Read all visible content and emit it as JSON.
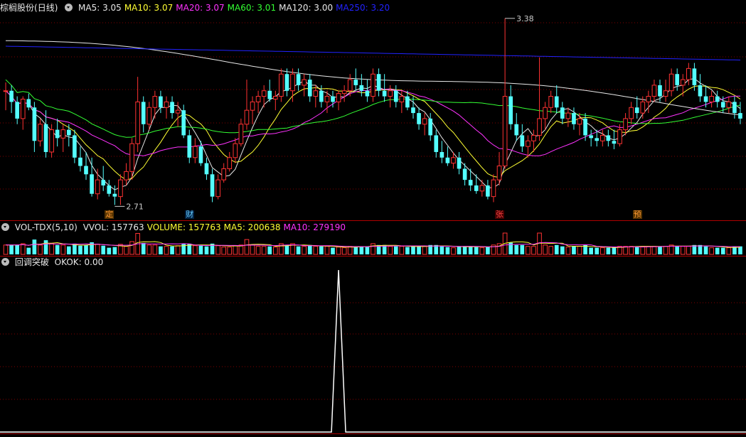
{
  "price_panel": {
    "stock_name": "棕榈股份",
    "period": "(日线)",
    "ma": [
      {
        "label": "MA5: 3.05",
        "color": "#e8e8e8"
      },
      {
        "label": "MA10: 3.07",
        "color": "#ffff33"
      },
      {
        "label": "MA20: 3.07",
        "color": "#ff33ff"
      },
      {
        "label": "MA60: 3.01",
        "color": "#33ff33"
      },
      {
        "label": "MA120: 3.00",
        "color": "#e8e8e8"
      },
      {
        "label": "MA250: 3.20",
        "color": "#2222ff"
      }
    ],
    "high_label": "3.38",
    "low_label": "2.71",
    "event_markers": [
      {
        "text": "定",
        "color": "#ff9933",
        "bg": "#553300"
      },
      {
        "text": "财",
        "color": "#66ccff",
        "bg": "#002244"
      },
      {
        "text": "张",
        "color": "#ff4444",
        "bg": "#440000"
      },
      {
        "text": "预",
        "color": "#ff9933",
        "bg": "#553300"
      }
    ]
  },
  "volume_panel": {
    "indicator": "VOL-TDX(5,10)",
    "items": [
      {
        "label": "VVOL: 157763",
        "color": "#e8e8e8"
      },
      {
        "label": "VOLUME: 157763",
        "color": "#ffff33"
      },
      {
        "label": "MA5: 200638",
        "color": "#ffff33"
      },
      {
        "label": "MA10: 279190",
        "color": "#ff33ff"
      }
    ]
  },
  "signal_panel": {
    "indicator": "回调突破",
    "value_label": "OKOK: 0.00"
  },
  "colors": {
    "up": "#ff3232",
    "down": "#54ffff",
    "grid": "#800000",
    "background": "#000000"
  },
  "chart_data": {
    "type": "candlestick",
    "candles": [
      [
        3.12,
        3.15,
        3.05,
        3.12
      ],
      [
        3.12,
        3.14,
        3.04,
        3.08
      ],
      [
        3.08,
        3.1,
        3.0,
        3.02
      ],
      [
        3.02,
        3.1,
        2.98,
        3.09
      ],
      [
        3.09,
        3.11,
        3.05,
        3.06
      ],
      [
        3.06,
        3.08,
        2.9,
        2.94
      ],
      [
        2.94,
        3.02,
        2.92,
        3.0
      ],
      [
        3.0,
        3.05,
        2.88,
        2.9
      ],
      [
        2.9,
        3.0,
        2.88,
        2.98
      ],
      [
        2.98,
        3.02,
        2.92,
        2.95
      ],
      [
        2.95,
        3.0,
        2.9,
        2.98
      ],
      [
        2.98,
        3.0,
        2.92,
        2.96
      ],
      [
        2.96,
        2.98,
        2.86,
        2.88
      ],
      [
        2.88,
        2.92,
        2.83,
        2.85
      ],
      [
        2.85,
        2.9,
        2.8,
        2.82
      ],
      [
        2.82,
        2.88,
        2.74,
        2.75
      ],
      [
        2.75,
        2.84,
        2.73,
        2.8
      ],
      [
        2.8,
        2.85,
        2.76,
        2.78
      ],
      [
        2.78,
        2.8,
        2.74,
        2.75
      ],
      [
        2.75,
        2.78,
        2.71,
        2.74
      ],
      [
        2.74,
        2.82,
        2.71,
        2.8
      ],
      [
        2.8,
        2.86,
        2.78,
        2.83
      ],
      [
        2.83,
        2.95,
        2.8,
        2.93
      ],
      [
        2.93,
        3.17,
        2.9,
        3.08
      ],
      [
        3.08,
        3.1,
        2.97,
        3.0
      ],
      [
        3.0,
        3.08,
        2.98,
        3.06
      ],
      [
        3.06,
        3.12,
        3.02,
        3.1
      ],
      [
        3.1,
        3.12,
        3.04,
        3.06
      ],
      [
        3.06,
        3.1,
        3.02,
        3.08
      ],
      [
        3.08,
        3.1,
        3.02,
        3.04
      ],
      [
        3.04,
        3.08,
        2.99,
        3.05
      ],
      [
        3.05,
        3.07,
        2.95,
        2.96
      ],
      [
        2.96,
        2.98,
        2.86,
        2.88
      ],
      [
        2.88,
        2.95,
        2.86,
        2.92
      ],
      [
        2.92,
        2.94,
        2.85,
        2.86
      ],
      [
        2.86,
        2.88,
        2.8,
        2.82
      ],
      [
        2.82,
        2.84,
        2.72,
        2.74
      ],
      [
        2.74,
        2.82,
        2.73,
        2.8
      ],
      [
        2.8,
        2.86,
        2.79,
        2.84
      ],
      [
        2.84,
        2.9,
        2.83,
        2.88
      ],
      [
        2.88,
        2.95,
        2.86,
        2.93
      ],
      [
        2.93,
        3.02,
        2.92,
        3.0
      ],
      [
        3.0,
        3.16,
        2.98,
        3.05
      ],
      [
        3.05,
        3.1,
        3.0,
        3.08
      ],
      [
        3.08,
        3.12,
        3.04,
        3.1
      ],
      [
        3.1,
        3.14,
        3.06,
        3.12
      ],
      [
        3.12,
        3.16,
        3.08,
        3.09
      ],
      [
        3.09,
        3.12,
        3.05,
        3.1
      ],
      [
        3.1,
        3.2,
        3.08,
        3.18
      ],
      [
        3.18,
        3.2,
        3.1,
        3.12
      ],
      [
        3.12,
        3.2,
        3.08,
        3.18
      ],
      [
        3.18,
        3.2,
        3.12,
        3.14
      ],
      [
        3.14,
        3.18,
        3.1,
        3.16
      ],
      [
        3.16,
        3.18,
        3.08,
        3.1
      ],
      [
        3.1,
        3.14,
        3.06,
        3.12
      ],
      [
        3.12,
        3.14,
        3.06,
        3.08
      ],
      [
        3.08,
        3.12,
        3.04,
        3.1
      ],
      [
        3.1,
        3.12,
        3.06,
        3.08
      ],
      [
        3.08,
        3.12,
        3.05,
        3.11
      ],
      [
        3.11,
        3.14,
        3.08,
        3.12
      ],
      [
        3.12,
        3.18,
        3.1,
        3.16
      ],
      [
        3.16,
        3.2,
        3.12,
        3.14
      ],
      [
        3.14,
        3.18,
        3.1,
        3.12
      ],
      [
        3.12,
        3.16,
        3.08,
        3.1
      ],
      [
        3.1,
        3.2,
        3.08,
        3.18
      ],
      [
        3.18,
        3.2,
        3.1,
        3.12
      ],
      [
        3.12,
        3.18,
        3.08,
        3.1
      ],
      [
        3.1,
        3.14,
        3.06,
        3.12
      ],
      [
        3.12,
        3.14,
        3.06,
        3.08
      ],
      [
        3.08,
        3.12,
        3.04,
        3.1
      ],
      [
        3.1,
        3.12,
        3.05,
        3.06
      ],
      [
        3.06,
        3.1,
        3.02,
        3.04
      ],
      [
        3.04,
        3.06,
        2.98,
        3.0
      ],
      [
        3.0,
        3.04,
        2.96,
        3.02
      ],
      [
        3.02,
        3.04,
        2.94,
        2.96
      ],
      [
        2.96,
        2.98,
        2.88,
        2.9
      ],
      [
        2.9,
        2.94,
        2.86,
        2.88
      ],
      [
        2.88,
        2.92,
        2.85,
        2.86
      ],
      [
        2.86,
        2.9,
        2.84,
        2.88
      ],
      [
        2.88,
        2.9,
        2.82,
        2.84
      ],
      [
        2.84,
        2.86,
        2.78,
        2.8
      ],
      [
        2.8,
        2.84,
        2.76,
        2.78
      ],
      [
        2.78,
        2.82,
        2.75,
        2.76
      ],
      [
        2.76,
        2.8,
        2.74,
        2.78
      ],
      [
        2.78,
        2.8,
        2.73,
        2.74
      ],
      [
        2.74,
        2.82,
        2.72,
        2.8
      ],
      [
        2.8,
        2.9,
        2.78,
        2.85
      ],
      [
        2.85,
        3.38,
        2.84,
        3.1
      ],
      [
        3.1,
        3.14,
        2.98,
        3.0
      ],
      [
        3.0,
        3.04,
        2.94,
        2.96
      ],
      [
        2.96,
        3.0,
        2.9,
        2.92
      ],
      [
        2.92,
        2.96,
        2.88,
        2.94
      ],
      [
        2.94,
        2.98,
        2.9,
        2.96
      ],
      [
        2.96,
        3.24,
        2.94,
        3.02
      ],
      [
        3.02,
        3.08,
        2.98,
        3.06
      ],
      [
        3.06,
        3.12,
        3.04,
        3.1
      ],
      [
        3.1,
        3.14,
        3.04,
        3.06
      ],
      [
        3.06,
        3.08,
        3.0,
        3.02
      ],
      [
        3.02,
        3.06,
        2.99,
        3.04
      ],
      [
        3.04,
        3.06,
        2.98,
        3.0
      ],
      [
        3.0,
        3.04,
        2.96,
        3.02
      ],
      [
        3.02,
        3.04,
        2.94,
        2.96
      ],
      [
        2.96,
        2.98,
        2.92,
        2.95
      ],
      [
        2.95,
        2.98,
        2.92,
        2.94
      ],
      [
        2.94,
        2.98,
        2.92,
        2.96
      ],
      [
        2.96,
        2.98,
        2.92,
        2.94
      ],
      [
        2.94,
        2.98,
        2.91,
        2.93
      ],
      [
        2.93,
        3.0,
        2.92,
        2.98
      ],
      [
        2.98,
        3.04,
        2.96,
        3.02
      ],
      [
        3.02,
        3.08,
        3.0,
        3.06
      ],
      [
        3.06,
        3.1,
        3.02,
        3.04
      ],
      [
        3.04,
        3.1,
        3.02,
        3.08
      ],
      [
        3.08,
        3.12,
        3.04,
        3.1
      ],
      [
        3.1,
        3.16,
        3.08,
        3.14
      ],
      [
        3.14,
        3.16,
        3.08,
        3.1
      ],
      [
        3.1,
        3.16,
        3.08,
        3.12
      ],
      [
        3.12,
        3.2,
        3.1,
        3.18
      ],
      [
        3.18,
        3.2,
        3.12,
        3.14
      ],
      [
        3.14,
        3.18,
        3.1,
        3.16
      ],
      [
        3.16,
        3.22,
        3.14,
        3.2
      ],
      [
        3.2,
        3.22,
        3.12,
        3.14
      ],
      [
        3.14,
        3.18,
        3.08,
        3.1
      ],
      [
        3.1,
        3.14,
        3.06,
        3.08
      ],
      [
        3.08,
        3.12,
        3.06,
        3.1
      ],
      [
        3.1,
        3.12,
        3.06,
        3.08
      ],
      [
        3.08,
        3.1,
        3.04,
        3.06
      ],
      [
        3.06,
        3.1,
        3.04,
        3.08
      ],
      [
        3.08,
        3.1,
        3.02,
        3.04
      ],
      [
        3.04,
        3.08,
        3.0,
        3.02
      ]
    ],
    "ma_lines": [
      {
        "name": "MA5",
        "color": "#e8e8e8",
        "period": 5
      },
      {
        "name": "MA10",
        "color": "#ffff33",
        "period": 10
      },
      {
        "name": "MA20",
        "color": "#ff33ff",
        "period": 20
      },
      {
        "name": "MA60",
        "color": "#33ff33",
        "period": 60
      },
      {
        "name": "MA120",
        "color": "#e8e8e8",
        "period": 120
      },
      {
        "name": "MA250",
        "color": "#2222ff",
        "period": 250
      }
    ],
    "price_range": [
      2.66,
      3.4
    ],
    "signal_spike_index": 58
  }
}
